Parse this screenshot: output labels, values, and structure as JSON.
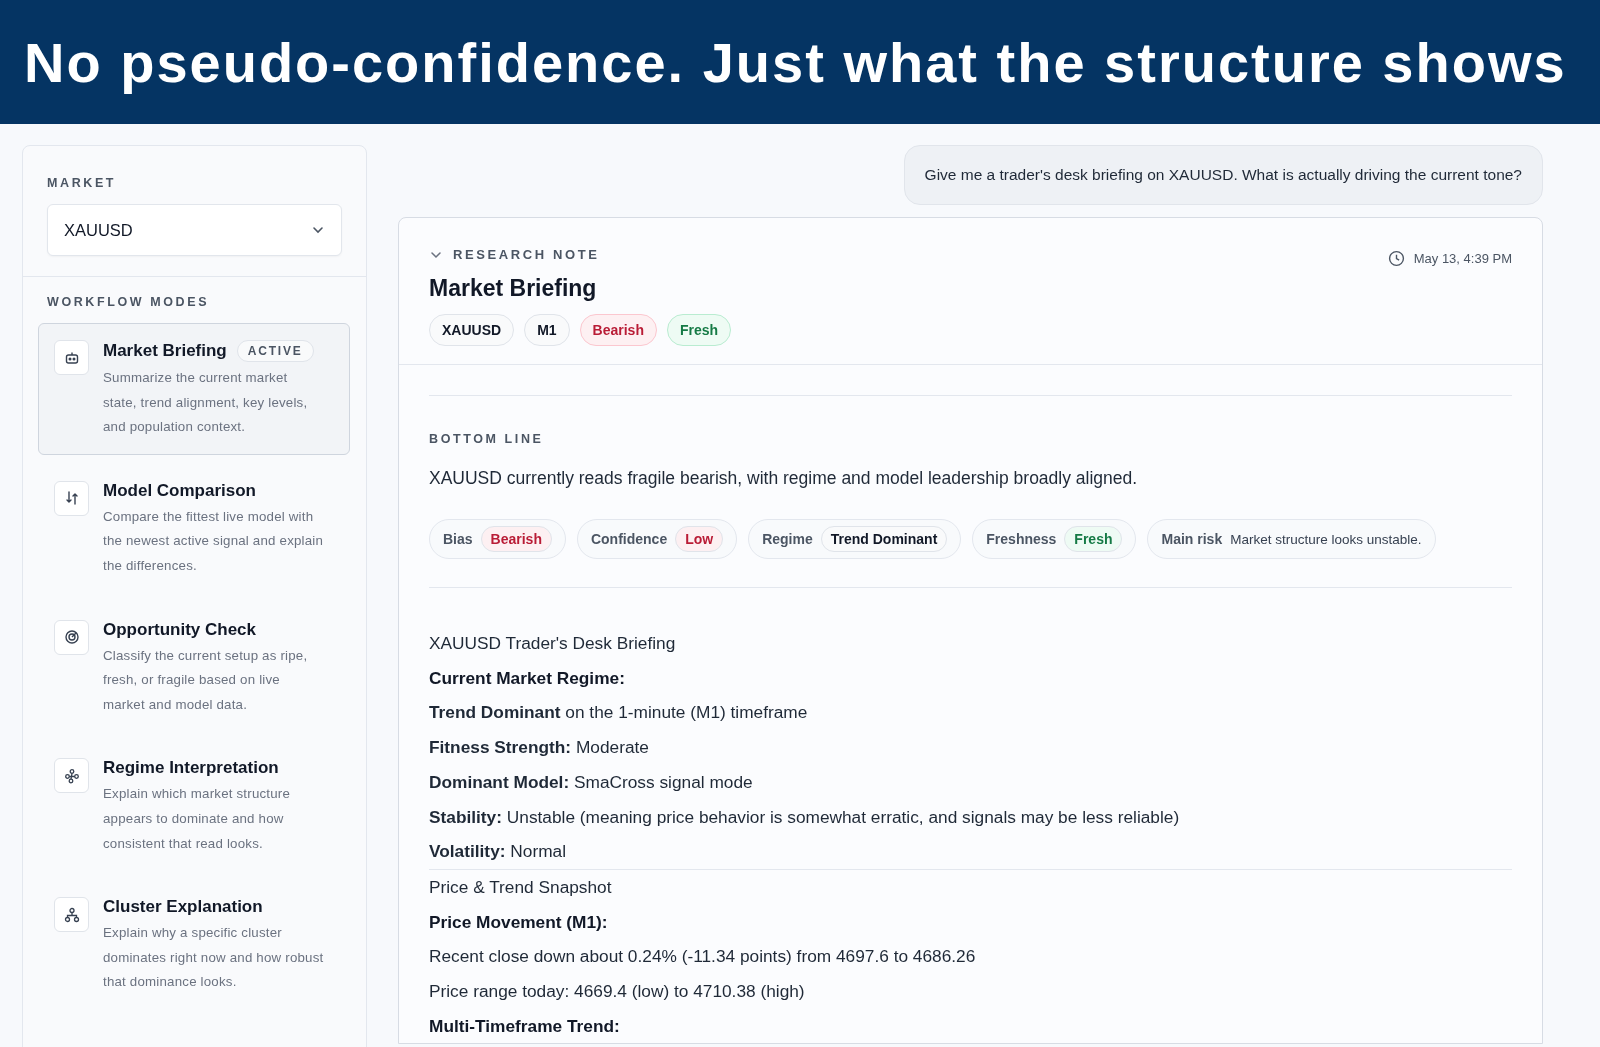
{
  "banner": {
    "title": "No pseudo-confidence. Just what the structure shows"
  },
  "sidebar": {
    "market_label": "MARKET",
    "market_select": {
      "value": "XAUUSD"
    },
    "modes_label": "WORKFLOW MODES",
    "modes": [
      {
        "kind": "robot",
        "title": "Market Briefing",
        "badge": "ACTIVE",
        "selected": true,
        "description": "Summarize the current market state, trend alignment, key levels, and population context."
      },
      {
        "kind": "swap",
        "title": "Model Comparison",
        "selected": false,
        "description": "Compare the fittest live model with the newest active signal and explain the differences."
      },
      {
        "kind": "target",
        "title": "Opportunity Check",
        "selected": false,
        "description": "Classify the current setup as ripe, fresh, or fragile based on live market and model data."
      },
      {
        "kind": "nodes",
        "title": "Regime Interpretation",
        "selected": false,
        "description": "Explain which market structure appears to dominate and how consistent that read looks."
      },
      {
        "kind": "hierarchy",
        "title": "Cluster Explanation",
        "selected": false,
        "description": "Explain why a specific cluster dominates right now and how robust that dominance looks."
      }
    ]
  },
  "user_message": "Give me a trader's desk briefing on XAUUSD. What is actually driving the current tone?",
  "research_note": {
    "label": "RESEARCH NOTE",
    "expanded": true,
    "timestamp": "May 13, 4:39 PM",
    "title": "Market Briefing",
    "tags": [
      {
        "text": "XAUUSD",
        "kind": "neutral"
      },
      {
        "text": "M1",
        "kind": "neutral"
      },
      {
        "text": "Bearish",
        "kind": "negative"
      },
      {
        "text": "Fresh",
        "kind": "positive"
      }
    ],
    "bottom_line_label": "BOTTOM LINE",
    "bottom_line": "XAUUSD currently reads fragile bearish, with regime and model leadership broadly aligned.",
    "summary": [
      {
        "label": "Bias",
        "value": "Bearish",
        "kind": "negative"
      },
      {
        "label": "Confidence",
        "value": "Low",
        "kind": "negative"
      },
      {
        "label": "Regime",
        "value": "Trend Dominant",
        "kind": "neutral"
      },
      {
        "label": "Freshness",
        "value": "Fresh",
        "kind": "positive"
      },
      {
        "label": "Main risk",
        "value": "Market structure looks unstable.",
        "kind": "plain"
      }
    ],
    "body": [
      {
        "kind": "plain",
        "text": "XAUUSD Trader's Desk Briefing"
      },
      {
        "kind": "heading",
        "text": "Current Market Regime:"
      },
      {
        "kind": "plain",
        "text": "**Trend Dominant** on the 1-minute (M1) timeframe"
      },
      {
        "kind": "plain",
        "text": "**Fitness Strength:** Moderate"
      },
      {
        "kind": "plain",
        "text": "**Dominant Model:** SmaCross signal mode"
      },
      {
        "kind": "plain",
        "text": "**Stability:** Unstable (meaning price behavior is somewhat erratic, and signals may be less reliable)"
      },
      {
        "kind": "plain",
        "text": "**Volatility:** Normal"
      },
      {
        "kind": "section",
        "text": "Price & Trend Snapshot"
      },
      {
        "kind": "heading",
        "text": "Price Movement (M1):"
      },
      {
        "kind": "plain",
        "text": "Recent close down about 0.24% (-11.34 points) from 4697.6 to 4686.26"
      },
      {
        "kind": "plain",
        "text": "Price range today: 4669.4 (low) to 4710.38 (high)"
      },
      {
        "kind": "heading",
        "text": "Multi-Timeframe Trend:"
      }
    ]
  }
}
